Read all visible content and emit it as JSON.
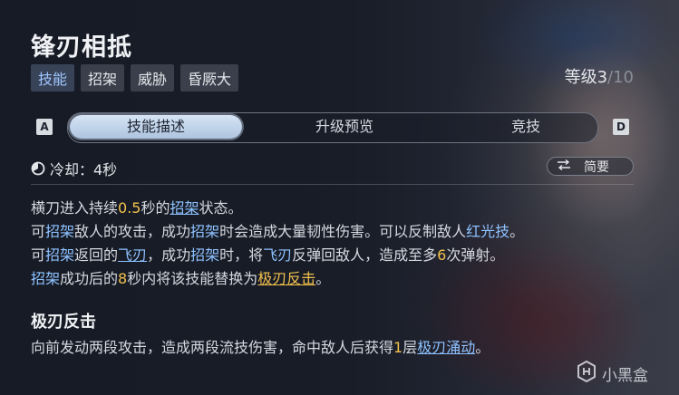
{
  "skill": {
    "title": "锋刃相抵",
    "tags": [
      "技能",
      "招架",
      "威胁",
      "昏厥大"
    ],
    "level_label": "等级",
    "level_current": "3",
    "level_max": "/10"
  },
  "tabs": {
    "left_key": "A",
    "right_key": "D",
    "items": [
      "技能描述",
      "升级预览",
      "竞技"
    ]
  },
  "cooldown": {
    "text": "冷却：4秒",
    "icon": "clock-icon"
  },
  "brief_toggle": {
    "label": "简要",
    "icon": "swap-arrows-icon"
  },
  "description": {
    "l1_a": "横刀进入持续",
    "l1_b": "0.5",
    "l1_c": "秒的",
    "l1_d": "招架",
    "l1_e": "状态。",
    "l2_a": "可",
    "l2_b": "招架",
    "l2_c": "敌人的攻击，成功",
    "l2_d": "招架",
    "l2_e": "时会造成大量韧性伤害。可以反制敌人",
    "l2_f": "红光技",
    "l2_g": "。",
    "l3_a": "可",
    "l3_b": "招架",
    "l3_c": "返回的",
    "l3_d": "飞刃",
    "l3_e": "，成功",
    "l3_f": "招架",
    "l3_g": "时，将",
    "l3_h": "飞刃",
    "l3_i": "反弹回敌人，造成至多",
    "l3_j": "6",
    "l3_k": "次弹射。",
    "l4_a": "招架",
    "l4_b": "成功后的",
    "l4_c": "8",
    "l4_d": "秒内将该技能替换为",
    "l4_e": "极刃反击",
    "l4_f": "。"
  },
  "sub_skill": {
    "title": "极刃反击",
    "d_a": "向前发动两段攻击，造成两段流技伤害，命中敌人后获得",
    "d_b": "1",
    "d_c": "层",
    "d_d": "极刃涌动",
    "d_e": "。"
  },
  "watermark": {
    "text": "小黑盒",
    "icon": "heybox-logo-icon"
  },
  "colors": {
    "keyword_blue": "#8ec2ff",
    "number_yellow": "#f2c04d",
    "active_tab": "#c3d6ec"
  }
}
